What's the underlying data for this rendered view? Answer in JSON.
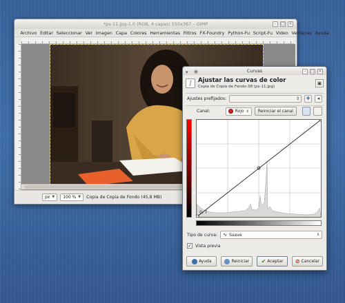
{
  "gimp": {
    "title": "*ps-11.jpg-1.0 (RGB, 4 capas) 550x367 – GIMP",
    "menu": [
      "Archivo",
      "Editar",
      "Seleccionar",
      "Ver",
      "Imagen",
      "Capa",
      "Colores",
      "Herramientas",
      "Filtros",
      "FX-Foundry",
      "Python-Fu",
      "Script-Fu",
      "Video",
      "Ventanas",
      "Ayuda"
    ],
    "status": {
      "unit": "px",
      "zoom": "100 %",
      "layer_info": "Copia de Copia de Fondo (45,8 MB)"
    }
  },
  "curves": {
    "window_title": "Curvas",
    "heading": "Ajustar las curvas de color",
    "subheading": "Copia de Copia de Fondo-38 (ps-11.jpg)",
    "presets_label": "Ajustes prefijados:",
    "channel_label": "Canal:",
    "channel_value": "Rojo",
    "reset_channel": "Reiniciar el canal",
    "point_readout": "0, 7",
    "curve_type_label": "Tipo de curva:",
    "curve_type_value": "Suave",
    "preview_label": "Vista previa",
    "preview_checked": true,
    "buttons": {
      "help": "Ayuda",
      "reset": "Reiniciar",
      "accept": "Aceptar",
      "cancel": "Cancelar"
    }
  },
  "colors": {
    "desktop": "#3f6ea9",
    "red_channel": "#d42020",
    "help_icon": "#3a6fb0",
    "accept_icon": "#2e8b2e",
    "cancel_icon": "#c62020"
  }
}
